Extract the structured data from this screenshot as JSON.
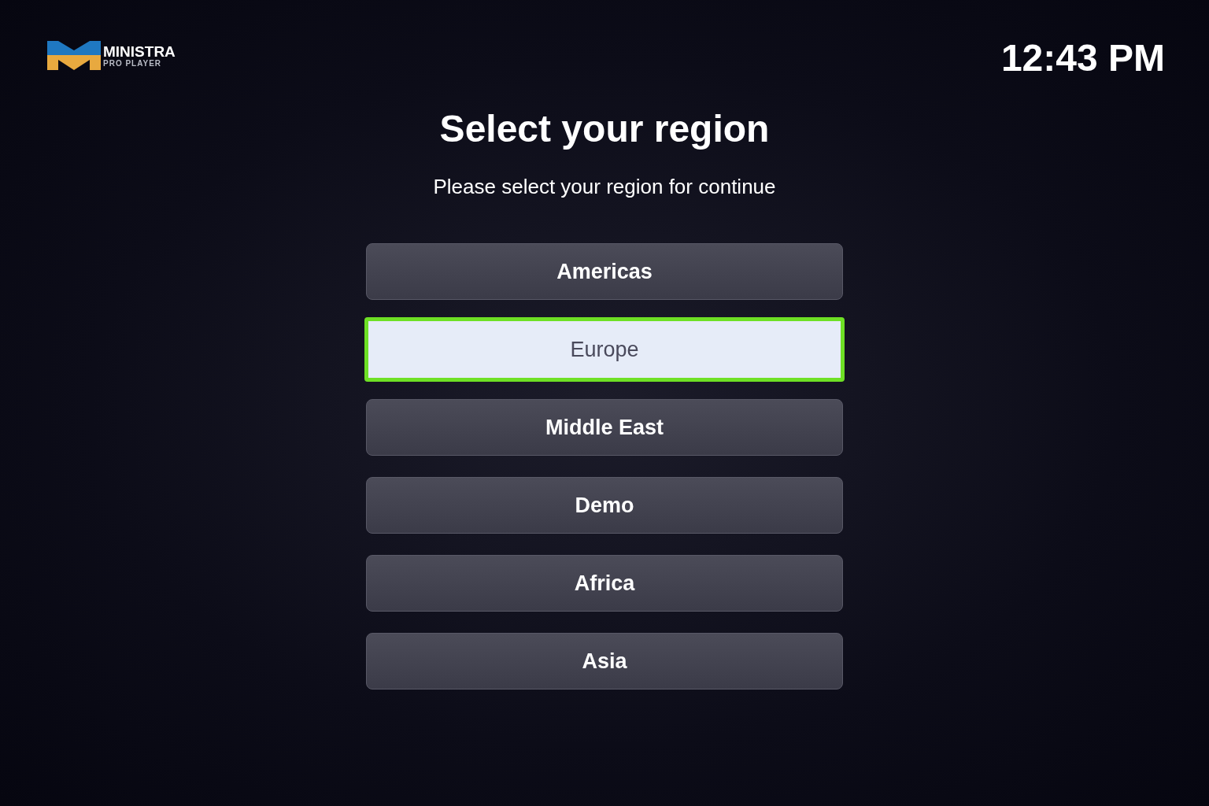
{
  "logo": {
    "name": "MINISTRA",
    "tagline": "PRO PLAYER"
  },
  "clock": "12:43 PM",
  "title": "Select your region",
  "subtitle": "Please select your region for continue",
  "regions": [
    {
      "label": "Americas",
      "selected": false
    },
    {
      "label": "Europe",
      "selected": true
    },
    {
      "label": "Middle East",
      "selected": false
    },
    {
      "label": "Demo",
      "selected": false
    },
    {
      "label": "Africa",
      "selected": false
    },
    {
      "label": "Asia",
      "selected": false
    }
  ]
}
